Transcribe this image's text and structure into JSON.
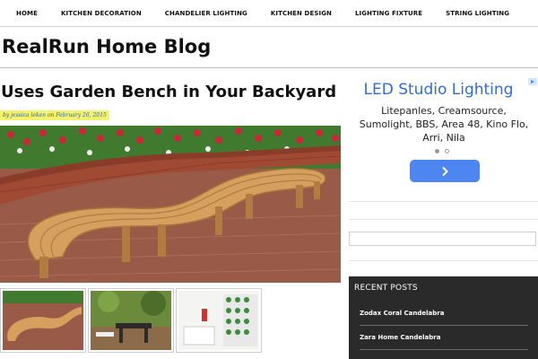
{
  "nav": {
    "items": [
      {
        "label": "HOME"
      },
      {
        "label": "KITCHEN DECORATION"
      },
      {
        "label": "CHANDELIER LIGHTING"
      },
      {
        "label": "KITCHEN DESIGN"
      },
      {
        "label": "LIGHTING FIXTURE"
      },
      {
        "label": "STRING LIGHTING"
      }
    ]
  },
  "site": {
    "title": "RealRun Home Blog"
  },
  "post": {
    "title": "Uses Garden Bench in Your Backyard",
    "meta_prefix": "by",
    "author": "jessica leken",
    "meta_mid": "on",
    "date": "February 26, 2015"
  },
  "ad": {
    "headline": "LED Studio Lighting",
    "body": "Litepanles, Creamsource, Sumolight, BBS, Area 48, Kino Flo, Arri, Nila",
    "arrow_icon": "chevron-right-icon",
    "button_color": "#4d86f0",
    "headline_color": "#2f6cd6"
  },
  "recent": {
    "title": "RECENT POSTS",
    "items": [
      {
        "label": "Zodax Coral Candelabra"
      },
      {
        "label": "Zara Home Candelabra"
      }
    ],
    "bg_color": "#2a2a2a"
  },
  "meta_highlight_color": "#f2f26c"
}
